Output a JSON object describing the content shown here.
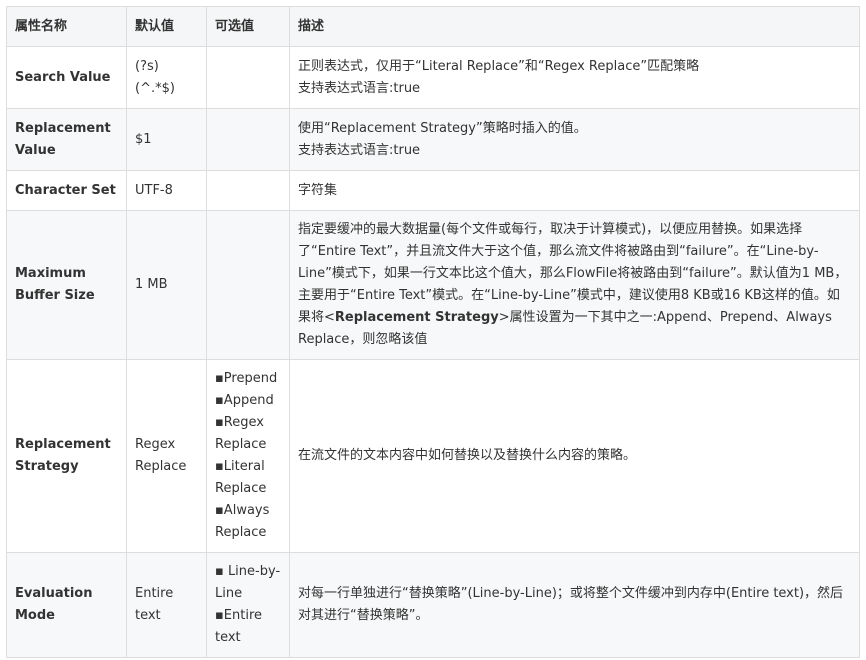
{
  "table": {
    "headers": [
      "属性名称",
      "默认值",
      "可选值",
      "描述"
    ],
    "rows": [
      {
        "name": "Search Value",
        "default": "(?s)(^.*$)",
        "options": [],
        "desc_lines": [
          "正则表达式，仅用于“Literal Replace”和“Regex Replace”匹配策略",
          "支持表达式语言:true"
        ]
      },
      {
        "name": "Replacement Value",
        "default": "$1",
        "options": [],
        "desc_lines": [
          "使用“Replacement Strategy”策略时插入的值。",
          "支持表达式语言:true"
        ]
      },
      {
        "name": "Character Set",
        "default": "UTF-8",
        "options": [],
        "desc_lines": [
          "字符集"
        ]
      },
      {
        "name": "Maximum Buffer Size",
        "default": "1 MB",
        "options": [],
        "desc_pre": "指定要缓冲的最大数据量(每个文件或每行，取决于计算模式)，以便应用替换。如果选择了“Entire Text”，并且流文件大于这个值，那么流文件将被路由到“failure”。在“Line-by-Line”模式下，如果一行文本比这个值大，那么FlowFile将被路由到“failure”。默认值为1 MB，主要用于“Entire Text”模式。在“Line-by-Line”模式中，建议使用8 KB或16 KB这样的值。如果将<",
        "desc_bold": "Replacement Strategy",
        "desc_post": ">属性设置为一下其中之一:Append、Prepend、Always Replace，则忽略该值"
      },
      {
        "name": "Replacement Strategy",
        "default": "Regex Replace",
        "options": [
          "▪Prepend",
          "▪Append",
          "▪Regex Replace",
          "▪Literal Replace",
          "▪Always Replace"
        ],
        "desc_lines": [
          "在流文件的文本内容中如何替换以及替换什么内容的策略。"
        ]
      },
      {
        "name": "Evaluation Mode",
        "default": "Entire text",
        "options": [
          "▪ Line-by-Line",
          "▪Entire text"
        ],
        "desc_lines": [
          "对每一行单独进行“替换策略”(Line-by-Line)；或将整个文件缓冲到内存中(Entire text)，然后对其进行“替换策略”。"
        ]
      }
    ]
  }
}
